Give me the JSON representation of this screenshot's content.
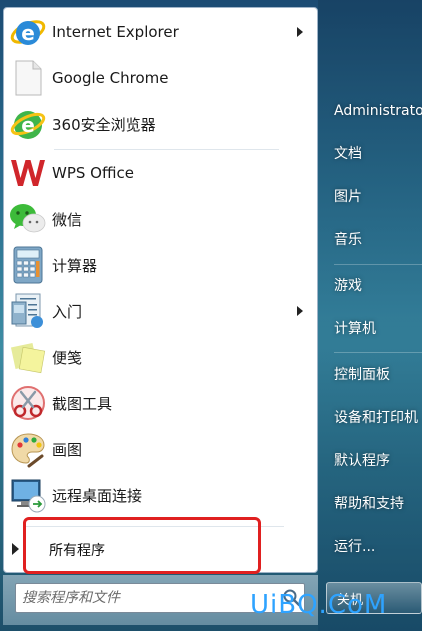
{
  "programs": [
    {
      "label": "Internet Explorer",
      "icon": "ie-icon",
      "has_submenu": true
    },
    {
      "label": "Google Chrome",
      "icon": "chrome-document-icon",
      "has_submenu": false
    },
    {
      "label": "360安全浏览器",
      "icon": "browser-360-icon",
      "has_submenu": false
    },
    {
      "label": "WPS Office",
      "icon": "wps-icon",
      "has_submenu": false
    },
    {
      "label": "微信",
      "icon": "wechat-icon",
      "has_submenu": false
    },
    {
      "label": "计算器",
      "icon": "calculator-icon",
      "has_submenu": false
    },
    {
      "label": "入门",
      "icon": "getting-started-icon",
      "has_submenu": true
    },
    {
      "label": "便笺",
      "icon": "sticky-notes-icon",
      "has_submenu": false
    },
    {
      "label": "截图工具",
      "icon": "snipping-tool-icon",
      "has_submenu": false
    },
    {
      "label": "画图",
      "icon": "paint-icon",
      "has_submenu": false
    },
    {
      "label": "远程桌面连接",
      "icon": "remote-desktop-icon",
      "has_submenu": false
    }
  ],
  "all_programs_label": "所有程序",
  "search": {
    "placeholder": "搜索程序和文件"
  },
  "right_items": [
    "Administrato",
    "文档",
    "图片",
    "音乐",
    "游戏",
    "计算机",
    "控制面板",
    "设备和打印机",
    "默认程序",
    "帮助和支持",
    "运行..."
  ],
  "shutdown_label": "关机",
  "watermark": "UiBQ.CoM",
  "colors": {
    "highlight": "#e02020",
    "watermark": "#2ea3ff"
  }
}
